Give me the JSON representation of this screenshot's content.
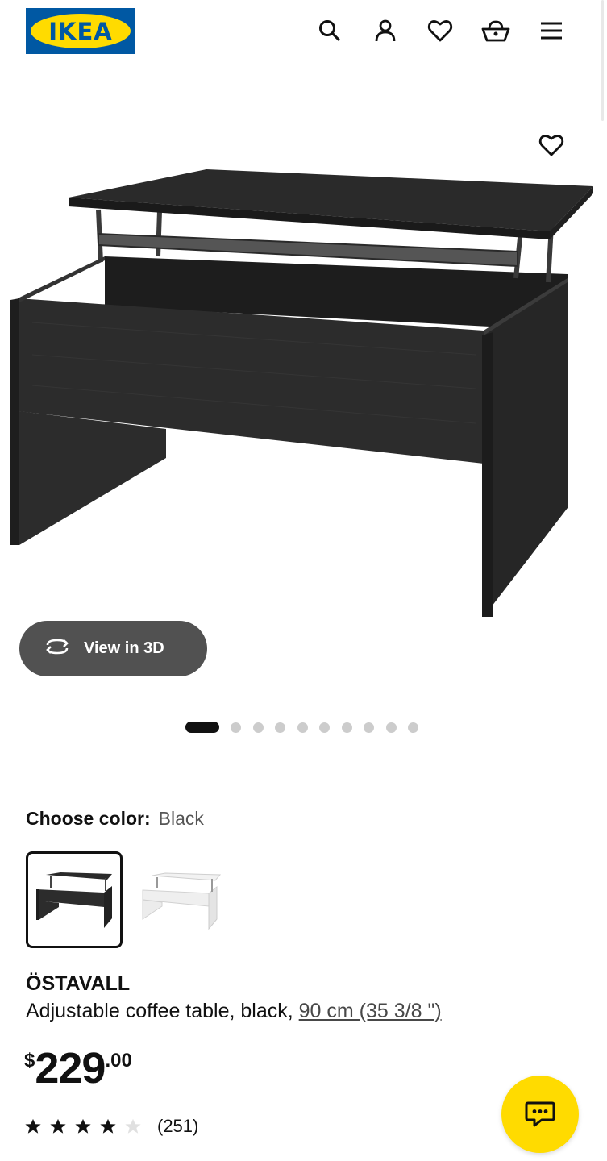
{
  "header": {
    "logo_text": "IKEA",
    "icons": [
      "search-icon",
      "account-icon",
      "heart-icon",
      "basket-icon",
      "menu-icon"
    ]
  },
  "hero": {
    "view3d_label": "View in 3D",
    "image_count": 10,
    "active_index": 0
  },
  "color": {
    "label": "Choose color:",
    "value": "Black",
    "options": [
      "Black",
      "White"
    ]
  },
  "product": {
    "name": "ÖSTAVALL",
    "description": "Adjustable coffee table, black,",
    "size_link": "90 cm (35 3/8 \")",
    "price_currency": "$",
    "price_int": "229",
    "price_dec": ".00",
    "rating": 4,
    "rating_max": 5,
    "review_count": "(251)"
  },
  "colors": {
    "brand_blue": "#0058a3",
    "brand_yellow": "#ffdb00",
    "table_black": "#262626"
  }
}
